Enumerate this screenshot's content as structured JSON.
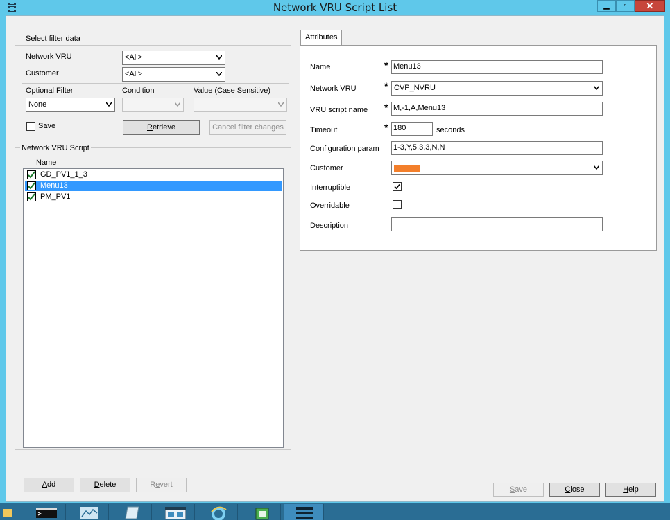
{
  "window": {
    "title": "Network VRU Script List",
    "minimize_label": "▁",
    "maximize_label": "▫",
    "close_label": "✕"
  },
  "filter": {
    "group_title": "Select filter data",
    "network_vru_label": "Network VRU",
    "network_vru_value": "<All>",
    "customer_label": "Customer",
    "customer_value": "<All>",
    "optional_filter_label": "Optional Filter",
    "optional_filter_value": "None",
    "condition_label": "Condition",
    "condition_value": "",
    "value_label": "Value (Case Sensitive)",
    "value_value": "",
    "save_label": "Save",
    "save_checked": false,
    "retrieve_label": "Retrieve",
    "cancel_label": "Cancel filter changes"
  },
  "script_list": {
    "group_title": "Network VRU Script",
    "column_header": "Name",
    "items": [
      {
        "name": "GD_PV1_1_3",
        "selected": false
      },
      {
        "name": "Menu13",
        "selected": true
      },
      {
        "name": "PM_PV1",
        "selected": false
      }
    ],
    "add_label": "Add",
    "delete_label": "Delete",
    "revert_label": "Revert"
  },
  "attributes": {
    "tab_label": "Attributes",
    "required_marker": "*",
    "name_label": "Name",
    "name_value": "Menu13",
    "network_vru_label": "Network VRU",
    "network_vru_value": "CVP_NVRU",
    "vru_script_name_label": "VRU script name",
    "vru_script_name_value": "M,-1,A,Menu13",
    "timeout_label": "Timeout",
    "timeout_value": "180",
    "timeout_unit": "seconds",
    "config_param_label": "Configuration param",
    "config_param_value": "1-3,Y,5,3,3,N,N",
    "customer_label": "Customer",
    "customer_swatch_color": "#f37f2b",
    "interruptible_label": "Interruptible",
    "interruptible_checked": true,
    "overridable_label": "Overridable",
    "overridable_checked": false,
    "description_label": "Description",
    "description_value": ""
  },
  "footer": {
    "save_label": "Save",
    "close_label": "Close",
    "help_label": "Help"
  },
  "taskbar": {
    "items": [
      "file-explorer-icon",
      "command-prompt-icon",
      "performance-monitor-icon",
      "notepad-icon",
      "configuration-manager-icon",
      "internet-explorer-icon",
      "network-tool-icon",
      "network-vru-script-icon"
    ]
  },
  "colors": {
    "titlebar": "#5fc8ea",
    "selection": "#3399ff",
    "close_button": "#c7463b",
    "taskbar": "#2a6d94"
  }
}
